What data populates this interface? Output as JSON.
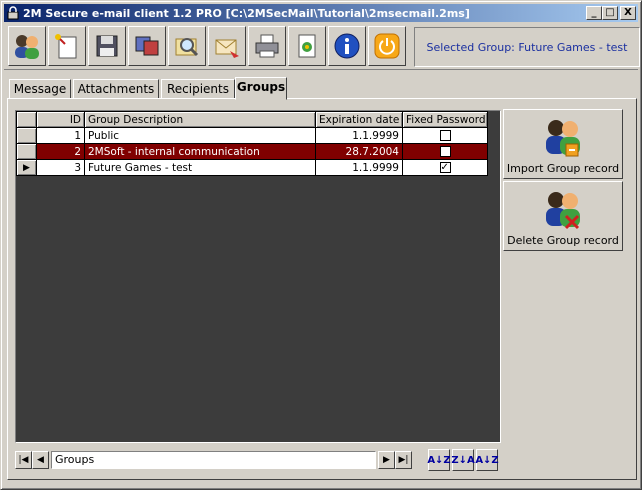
{
  "window": {
    "title": "2M Secure e-mail client 1.2 PRO [C:\\2MSecMail\\Tutorial\\2msecmail.2ms]",
    "minimize": "_",
    "maximize": "□",
    "close": "X"
  },
  "toolbar": {
    "buttons": [
      {
        "icon": "users-icon"
      },
      {
        "icon": "new-message-icon"
      },
      {
        "icon": "save-icon"
      },
      {
        "icon": "exchange-icon"
      },
      {
        "icon": "find-icon"
      },
      {
        "icon": "send-mail-icon"
      },
      {
        "icon": "print-icon"
      },
      {
        "icon": "wizard-icon"
      },
      {
        "icon": "info-icon"
      },
      {
        "icon": "power-icon"
      }
    ],
    "selected_group": "Selected Group: Future Games - test"
  },
  "tabs": [
    {
      "label": "Message",
      "active": false
    },
    {
      "label": "Attachments",
      "active": false
    },
    {
      "label": "Recipients",
      "active": false
    },
    {
      "label": "Groups",
      "active": true
    }
  ],
  "grid": {
    "columns": [
      "ID",
      "Group Description",
      "Expiration date",
      "Fixed Password"
    ],
    "rows": [
      {
        "id": "1",
        "description": "Public",
        "expiration": "1.1.9999",
        "fixed_password": false,
        "selected": false,
        "current": false
      },
      {
        "id": "2",
        "description": "2MSoft - internal communication",
        "expiration": "28.7.2004",
        "fixed_password": false,
        "selected": true,
        "current": false
      },
      {
        "id": "3",
        "description": "Future Games - test",
        "expiration": "1.1.9999",
        "fixed_password": true,
        "selected": false,
        "current": true
      }
    ]
  },
  "side_buttons": {
    "import": "Import Group record",
    "delete": "Delete Group record"
  },
  "navigator": {
    "label": "Groups",
    "first": "|◀",
    "prev": "◀",
    "next": "▶",
    "last": "▶|"
  },
  "sort_buttons": [
    "A↓Z",
    "Z↓A",
    "A↓Z"
  ]
}
